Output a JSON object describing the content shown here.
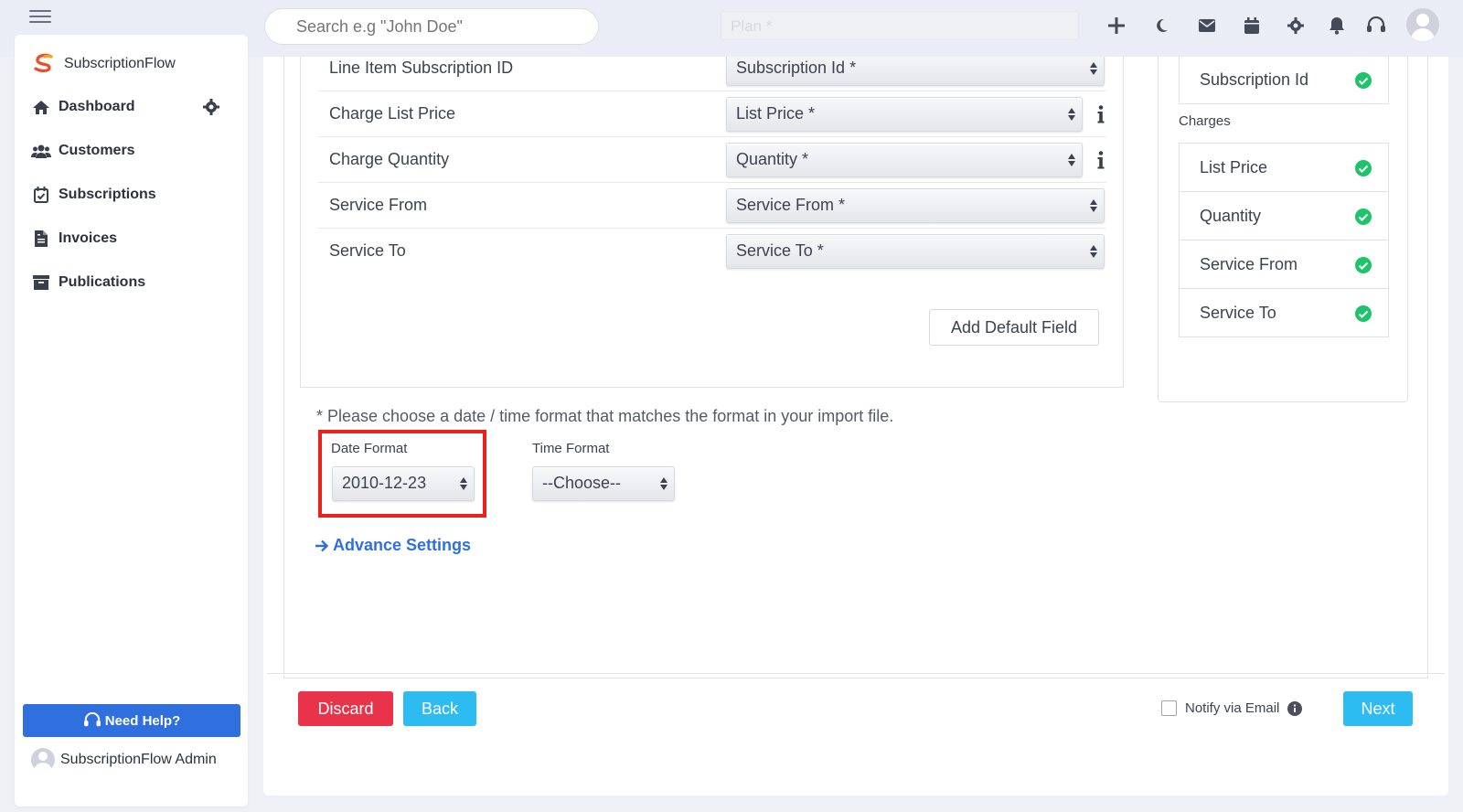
{
  "topbar": {
    "search_placeholder": "Search e.g \"John Doe\"",
    "ghost_field": "Plan *"
  },
  "sidebar": {
    "brand": "SubscriptionFlow",
    "items": [
      {
        "label": "Dashboard",
        "icon": "home-icon"
      },
      {
        "label": "Customers",
        "icon": "users-icon"
      },
      {
        "label": "Subscriptions",
        "icon": "calendar-check-icon"
      },
      {
        "label": "Invoices",
        "icon": "file-invoice-icon"
      },
      {
        "label": "Publications",
        "icon": "archive-icon"
      }
    ],
    "help_label": "Need Help?",
    "user_name": "SubscriptionFlow Admin"
  },
  "mapping": {
    "rows": [
      {
        "label": "Line Item Subscription ID",
        "value": "Subscription Id *"
      },
      {
        "label": "Charge List Price",
        "value": "List Price *"
      },
      {
        "label": "Charge Quantity",
        "value": "Quantity *"
      },
      {
        "label": "Service From",
        "value": "Service From *"
      },
      {
        "label": "Service To",
        "value": "Service To *"
      }
    ],
    "add_default_label": "Add Default Field"
  },
  "right_panel": {
    "top_item": "Subscription Id",
    "charges_heading": "Charges",
    "charges": [
      "List Price",
      "Quantity",
      "Service From",
      "Service To"
    ]
  },
  "format": {
    "note": "* Please choose a date / time format that matches the format in your import file.",
    "date_label": "Date Format",
    "date_value": "2010-12-23",
    "time_label": "Time Format",
    "time_value": "--Choose--",
    "advance_label": "Advance Settings"
  },
  "footer": {
    "discard": "Discard",
    "back": "Back",
    "notify": "Notify via Email",
    "next": "Next"
  },
  "colors": {
    "primary": "#2f6fde",
    "discard": "#e8334a",
    "accent": "#2dbcf2",
    "success": "#1ec46a",
    "highlight": "#e9231b"
  }
}
